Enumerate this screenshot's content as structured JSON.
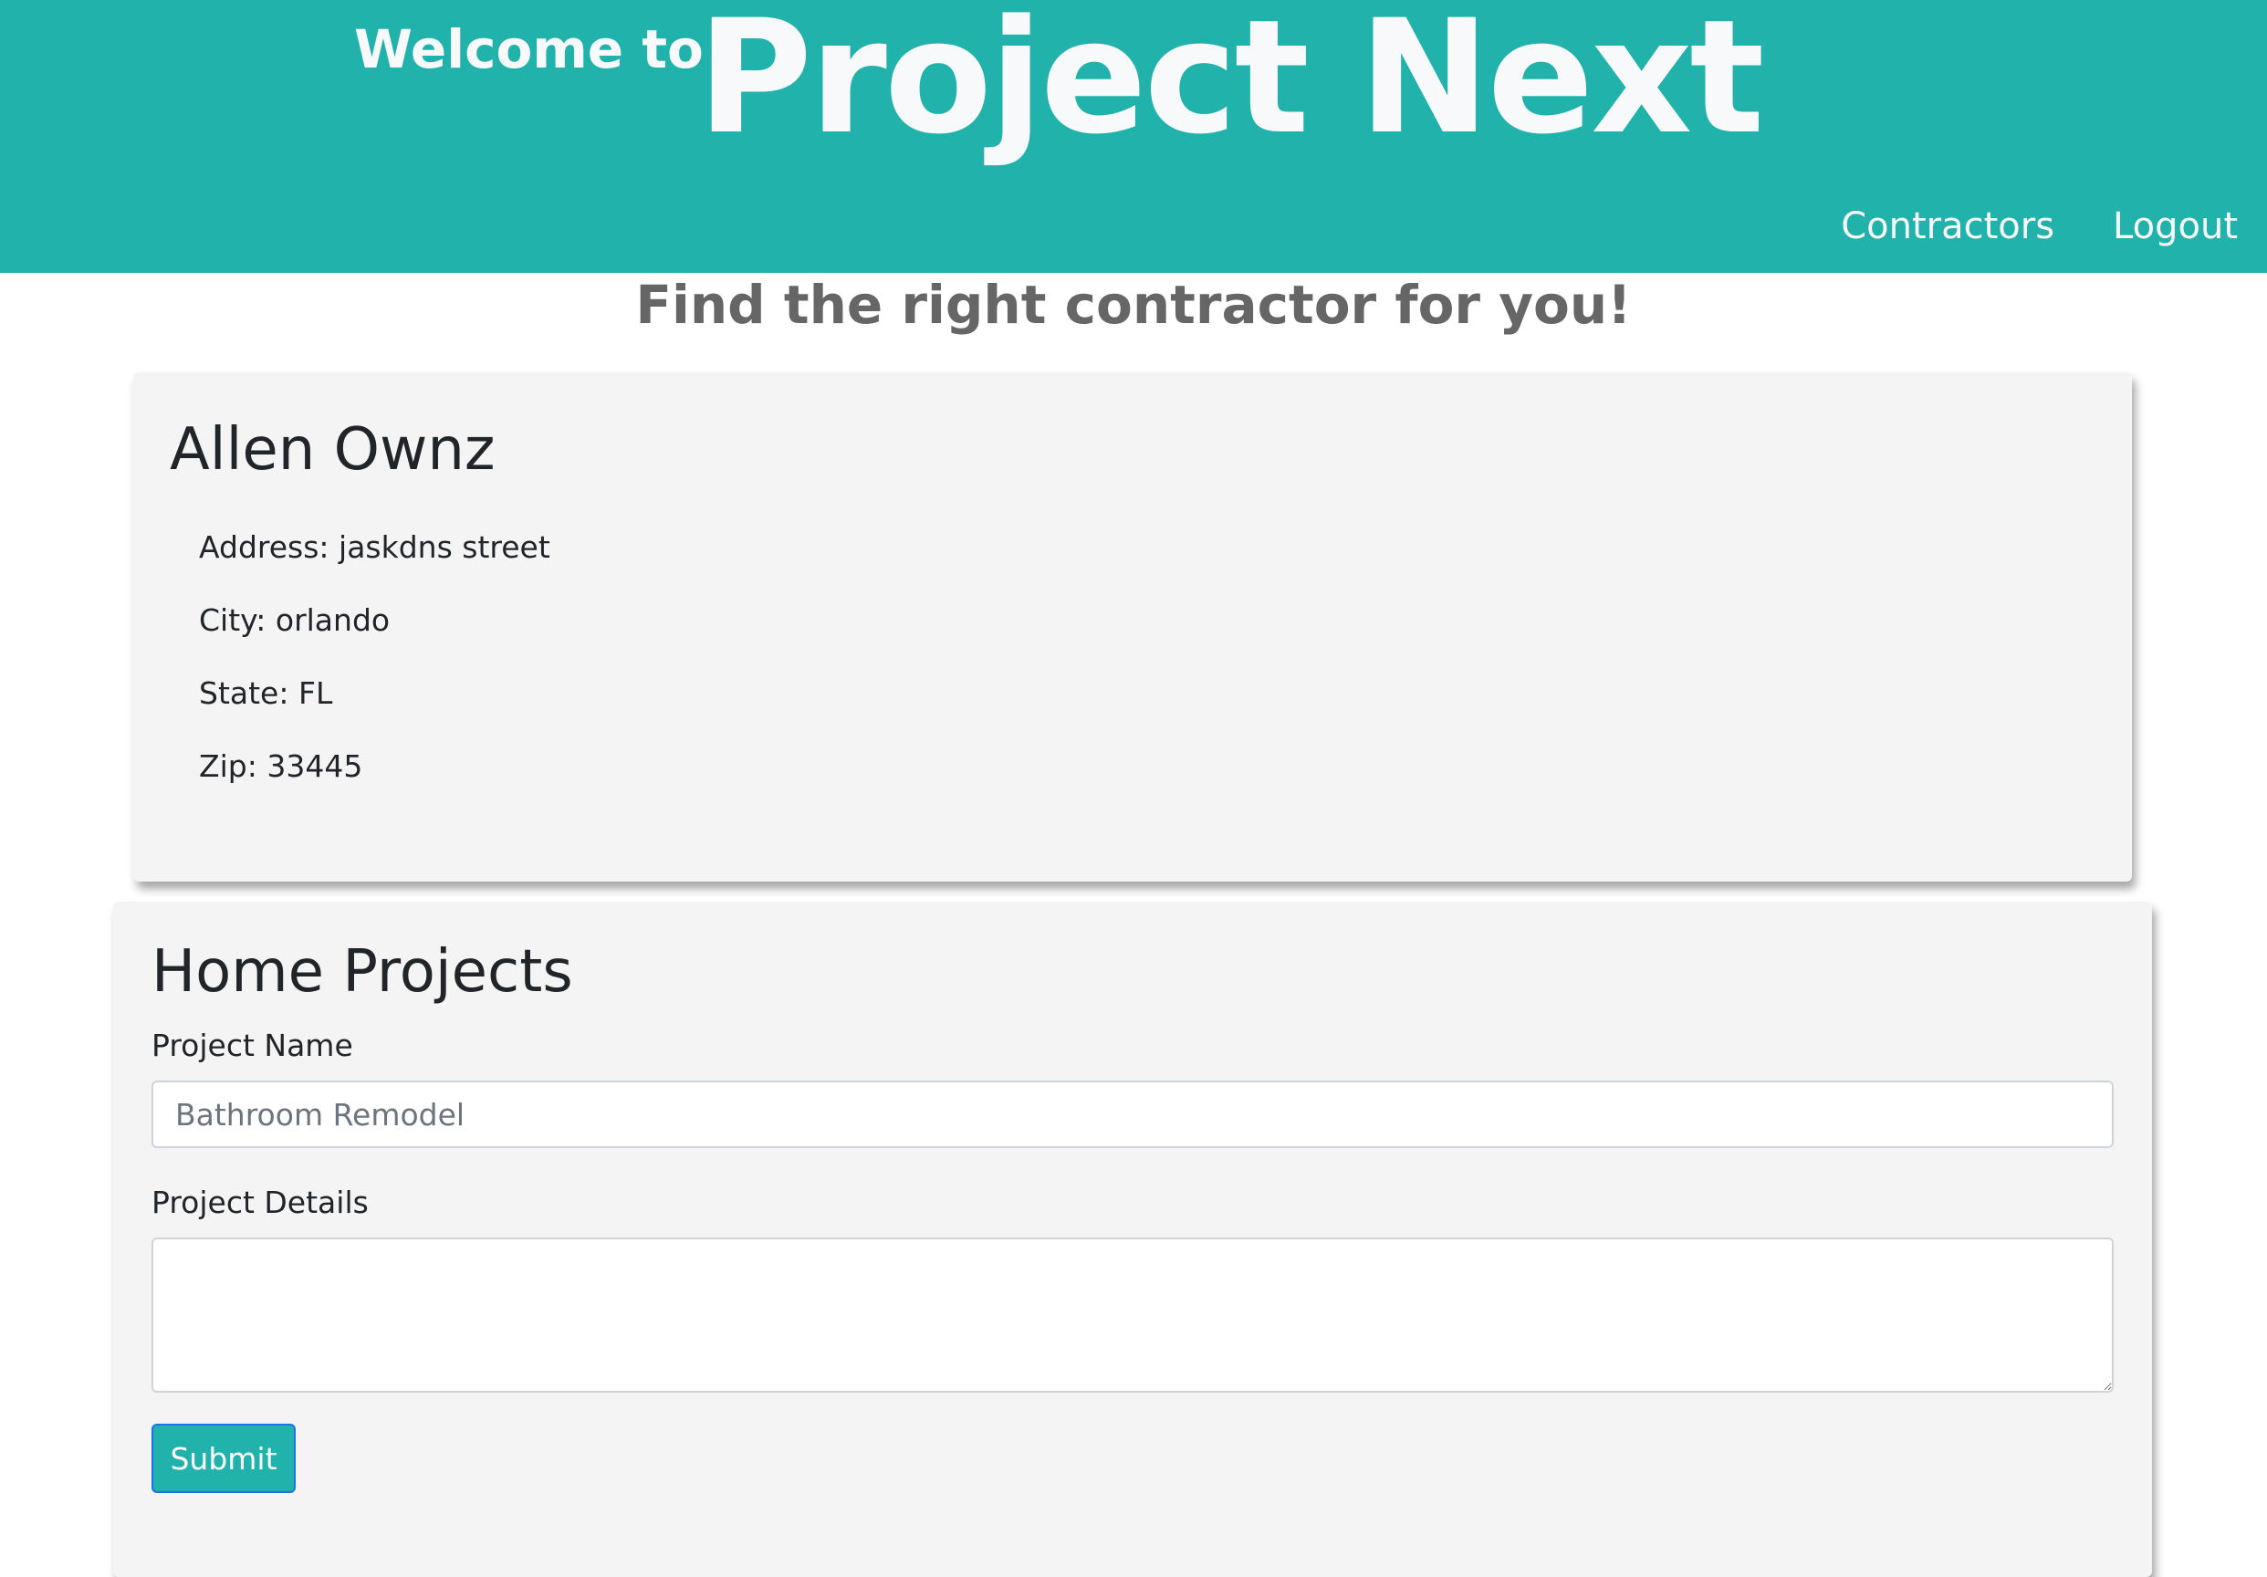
{
  "header": {
    "welcome_text": "Welcome to",
    "brand_name": "Project Next",
    "background_color": "#21b2ac",
    "nav": {
      "contractors_label": "Contractors",
      "logout_label": "Logout"
    }
  },
  "tagline": "Find the right contractor for you!",
  "profile": {
    "name": "Allen Ownz",
    "address": "Address: jaskdns street",
    "city": "City: orlando",
    "state": "State: FL",
    "zip": "Zip: 33445"
  },
  "projects": {
    "title": "Home Projects",
    "project_name_label": "Project Name",
    "project_name_placeholder": "Bathroom Remodel",
    "project_name_value": "",
    "project_details_label": "Project Details",
    "project_details_value": "",
    "submit_label": "Submit"
  },
  "colors": {
    "accent": "#21b2ac",
    "card_background": "#f4f4f4",
    "tagline_text": "#666666"
  }
}
